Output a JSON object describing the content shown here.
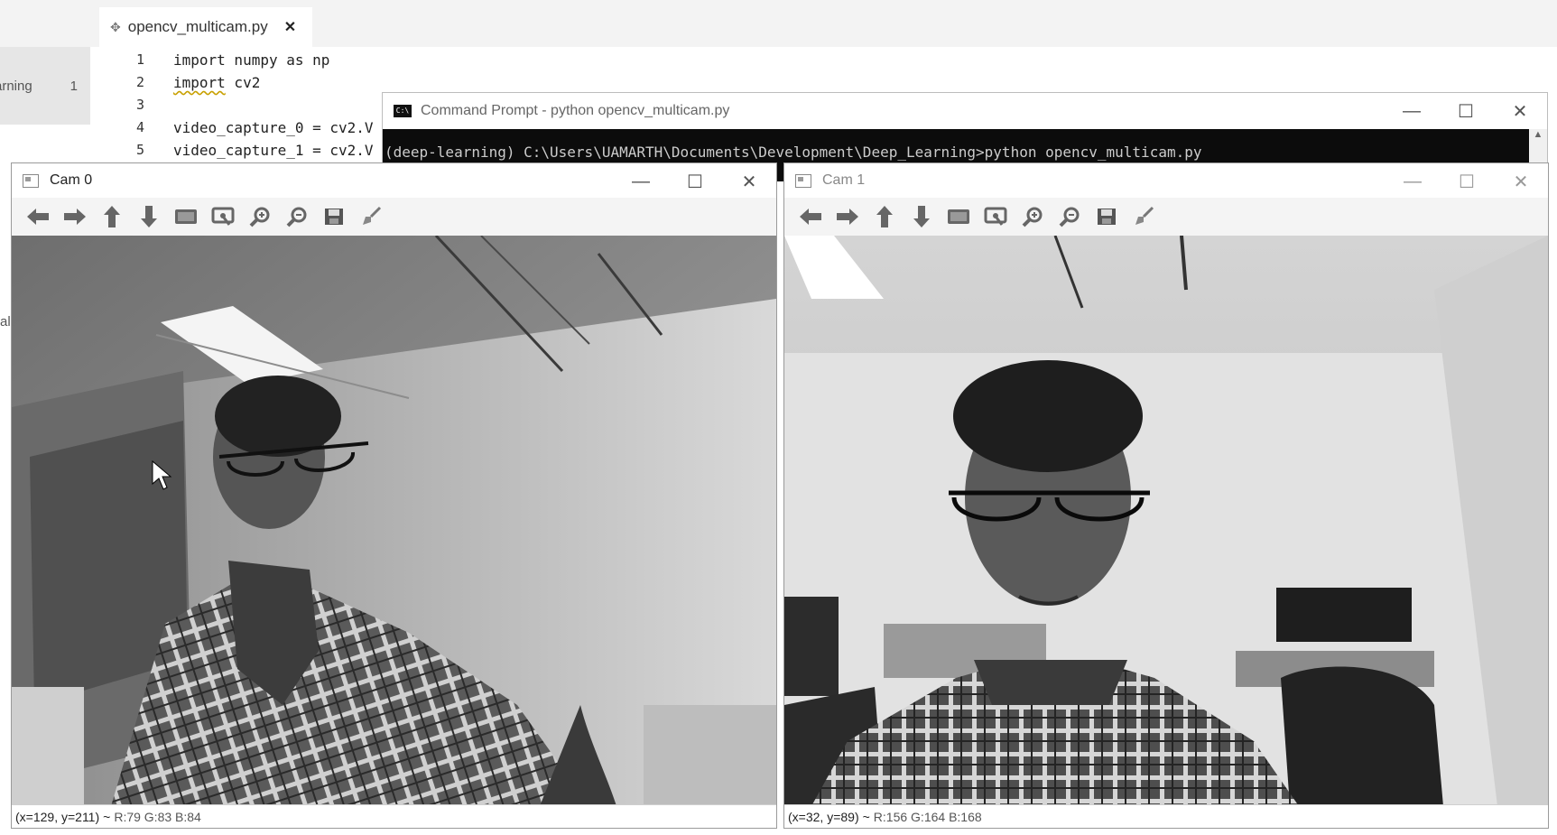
{
  "editor": {
    "tab_label": "opencv_multicam.py",
    "tab_close": "✕",
    "sidebar_item_label": "arning",
    "sidebar_item_count": "1",
    "sidebar_side_text": "al",
    "line_numbers": [
      "1",
      "2",
      "3",
      "4",
      "5"
    ],
    "code_lines": [
      "import numpy as np",
      "import",
      "",
      "video_capture_0 = cv2.V",
      "video_capture_1 = cv2.V"
    ],
    "line2_rest": " cv2"
  },
  "cmd": {
    "title": "Command Prompt - python  opencv_multicam.py",
    "icon_text": "C:\\",
    "console_line": "(deep-learning) C:\\Users\\UAMARTH\\Documents\\Development\\Deep_Learning>python opencv_multicam.py",
    "minimize": "—",
    "maximize": "☐",
    "close": "✕",
    "scroll_up": "▲"
  },
  "cam0": {
    "title": "Cam 0",
    "status_coord": "(x=129, y=211)",
    "status_sep": "~",
    "status_rgb": "R:79 G:83 B:84",
    "minimize": "—",
    "maximize": "☐",
    "close": "✕"
  },
  "cam1": {
    "title": "Cam 1",
    "status_coord": "(x=32, y=89)",
    "status_sep": "~",
    "status_rgb": "R:156 G:164 B:168",
    "minimize": "—",
    "maximize": "☐",
    "close": "✕"
  },
  "toolbar_icons": [
    "pan-left-icon",
    "pan-right-icon",
    "pan-up-icon",
    "pan-down-icon",
    "zoom-original-icon",
    "zoom-fit-icon",
    "zoom-in-icon",
    "zoom-out-icon",
    "save-icon",
    "properties-icon"
  ],
  "colors": {
    "console_bg": "#0c0c0c",
    "console_text": "#cccccc",
    "window_border": "#9a9a9a"
  }
}
